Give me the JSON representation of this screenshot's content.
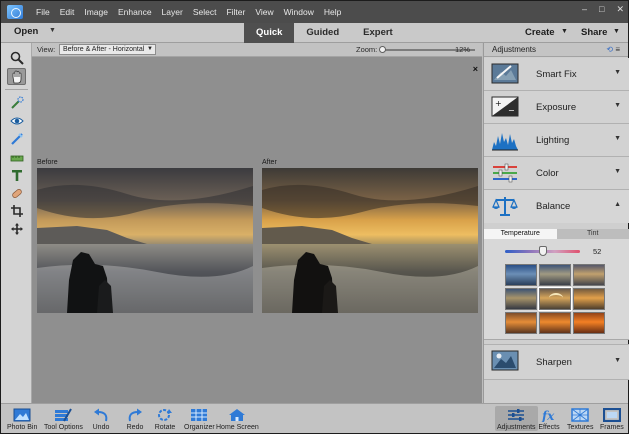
{
  "menubar": {
    "items": [
      "File",
      "Edit",
      "Image",
      "Enhance",
      "Layer",
      "Select",
      "Filter",
      "View",
      "Window",
      "Help"
    ],
    "window_controls": [
      "–",
      "□",
      "✕"
    ]
  },
  "modebar": {
    "open_label": "Open",
    "tabs": [
      {
        "label": "Quick",
        "active": true
      },
      {
        "label": "Guided",
        "active": false
      },
      {
        "label": "Expert",
        "active": false
      }
    ],
    "create_label": "Create",
    "share_label": "Share"
  },
  "toolbox": {
    "tools": [
      "zoom-tool",
      "hand-tool",
      "quick-selection-tool",
      "red-eye-tool",
      "whiten-teeth-tool",
      "straighten-tool",
      "type-tool",
      "spot-healing-tool",
      "crop-tool",
      "move-tool"
    ],
    "active_tool": "hand-tool"
  },
  "options": {
    "view_label": "View:",
    "view_value": "Before & After - Horizontal",
    "zoom_label": "Zoom:",
    "zoom_value": "12%"
  },
  "canvas": {
    "close_glyph": "×",
    "before_label": "Before",
    "after_label": "After"
  },
  "panel": {
    "title": "Adjustments",
    "adjustments": [
      {
        "label": "Smart Fix",
        "icon": "smart-fix-icon",
        "expanded": false
      },
      {
        "label": "Exposure",
        "icon": "exposure-icon",
        "expanded": false
      },
      {
        "label": "Lighting",
        "icon": "lighting-icon",
        "expanded": false
      },
      {
        "label": "Color",
        "icon": "color-icon",
        "expanded": false
      },
      {
        "label": "Balance",
        "icon": "balance-icon",
        "expanded": true
      }
    ],
    "balance": {
      "tabs": [
        {
          "label": "Temperature",
          "active": true
        },
        {
          "label": "Tint",
          "active": false
        }
      ],
      "temperature_value": "52",
      "temperature_level": 0.52,
      "selected_thumb": 4
    },
    "sharpen_label": "Sharpen"
  },
  "bottombar": {
    "left": [
      {
        "label": "Photo Bin",
        "icon": "photo-bin-icon"
      },
      {
        "label": "Tool Options",
        "icon": "tool-options-icon"
      },
      {
        "label": "Undo",
        "icon": "undo-icon"
      },
      {
        "label": "Redo",
        "icon": "redo-icon"
      },
      {
        "label": "Rotate",
        "icon": "rotate-icon"
      },
      {
        "label": "Organizer",
        "icon": "organizer-icon"
      },
      {
        "label": "Home Screen",
        "icon": "home-screen-icon"
      }
    ],
    "right": [
      {
        "label": "Adjustments",
        "icon": "adjustments-icon",
        "active": true
      },
      {
        "label": "Effects",
        "icon": "effects-icon",
        "active": false
      },
      {
        "label": "Textures",
        "icon": "textures-icon",
        "active": false
      },
      {
        "label": "Frames",
        "icon": "frames-icon",
        "active": false
      }
    ]
  },
  "colors": {
    "accent_blue": "#2f7ad6",
    "menubar_bg": "#4c4c4c",
    "active_tab_bg": "#4f4f4f",
    "canvas_bg": "#8f8f8f"
  }
}
